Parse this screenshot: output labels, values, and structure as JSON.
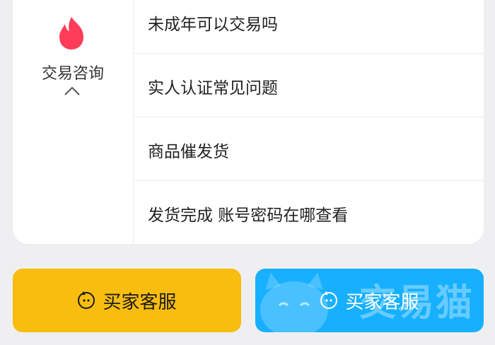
{
  "category": {
    "label": "交易咨询",
    "icon": "flame-icon",
    "accent": "#ff3d5a"
  },
  "questions": [
    "未成年可以交易吗",
    "实人认证常见问题",
    "商品催发货",
    "发货完成 账号密码在哪查看"
  ],
  "buttons": {
    "buyer_service_primary": "买家客服",
    "buyer_service_secondary": "买家客服",
    "watermark": "交易猫",
    "primary_color": "#f8bd0f",
    "secondary_color": "#17b0ff"
  }
}
